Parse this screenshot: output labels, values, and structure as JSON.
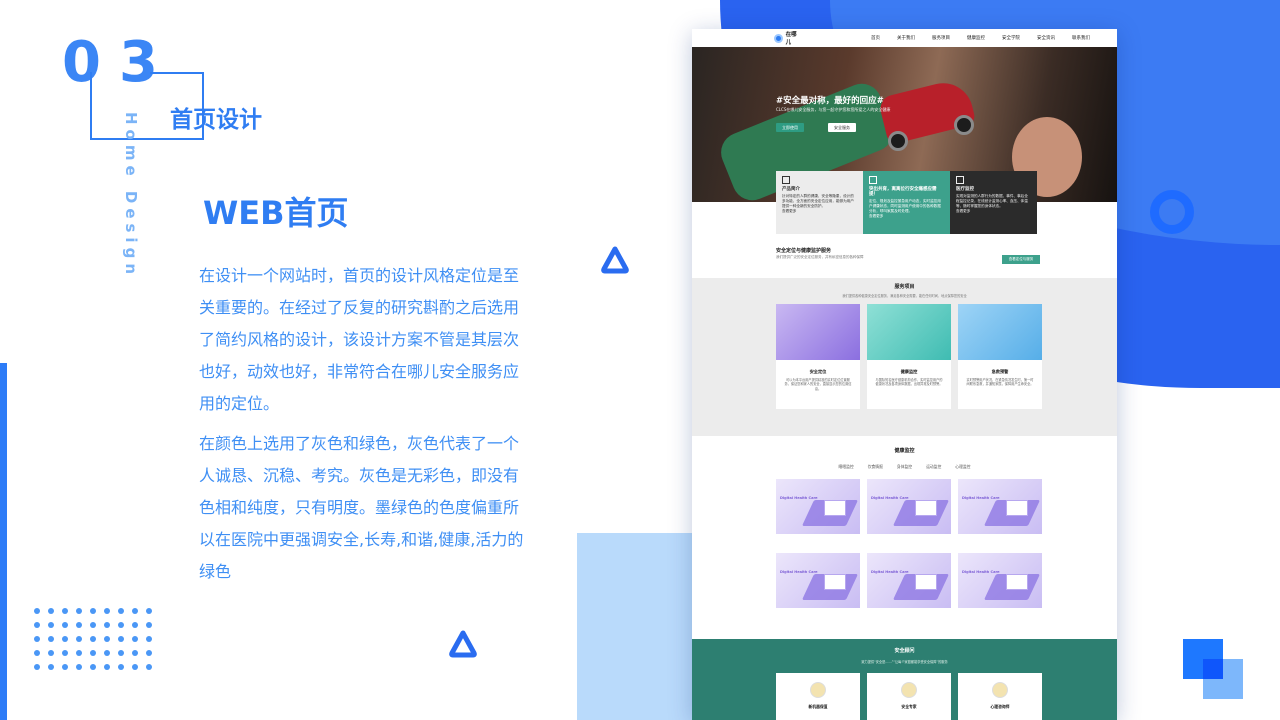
{
  "slide": {
    "number": "03",
    "section_title": "首页设计",
    "section_en": "Home Design",
    "heading": "WEB首页",
    "paragraph_1": "在设计一个网站时，首页的设计风格定位是至关重要的。在经过了反复的研究斟酌之后选用了简约风格的设计，该设计方案不管是其层次也好，动效也好，非常符合在哪儿安全服务应用的定位。",
    "paragraph_2": "在颜色上选用了灰色和绿色，灰色代表了一个人诚恳、沉稳、考究。灰色是无彩色，即没有色相和纯度，只有明度。墨绿色的色度偏重所以在医院中更强调安全,长寿,和谐,健康,活力的绿色"
  },
  "colors": {
    "accent": "#2f7df2",
    "mock_green": "#3da18c",
    "mock_dark_green": "#2d7f71",
    "mock_gray": "#ececec"
  },
  "mockup": {
    "logo_text": "在哪儿",
    "nav": [
      "首页",
      "关于我们",
      "服务项目",
      "健康监控",
      "安全学院",
      "安全资讯",
      "联系我们"
    ],
    "hero": {
      "title": "#安全最对称，最好的回应#",
      "subtitle": "CLCS在哪儿安全服务，与您一起守护您和您所爱之人的安全健康",
      "primary_button": "立即使用",
      "secondary_button": "安全服务"
    },
    "feature_cards": [
      {
        "title": "产品简介",
        "text": "针对特定的人群的健康、安全等隐患，设计的多功能、全方面的安全定位应用，能够为用户提供一种全新的安全防护。",
        "more": "查看更多"
      },
      {
        "title": "突出共育，离离位行安全痛感应需提！",
        "text": "定位、规划及监控紧急用户动态，实时监控用户健康状态，同时监测用户使用中的各种数据分析，呼叫家属及时处理。",
        "more": "查看更多"
      },
      {
        "title": "医疗监控",
        "text": "实现对监测的人群行为的数据、事件、事后全程监控记录，在线统计监测心率、血压、体温等，随时掌握您的身体状态。",
        "more": "查看更多"
      }
    ],
    "block2": {
      "title": "安全定位与健康监护服务",
      "subtitle": "我们提供广泛的安全定位服务，并有私密信息的各种保障",
      "button": "查看定位与服务"
    },
    "services": {
      "title": "服务项目",
      "subtitle": "我们提供各种健康安全定位服务，满足各种安全需要，能在任何时间、地点保障您的安全",
      "items": [
        {
          "name": "安全定位",
          "desc": "可以为本平台用户提供精准的实时定位位置服务，保证您和家人的安全，直接显示您的位置信息。"
        },
        {
          "name": "健康监控",
          "desc": "与国际知名医疗健康机构合作，实时监控用户的健康状况及各项身体数据，出现异常及时预警。"
        },
        {
          "name": "急救预警",
          "desc": "实时预警用户状况，在紧急情况发生时，第一时间联系急救，并通知家属，保障用户生命安全。"
        }
      ]
    },
    "health": {
      "title": "健康监控",
      "tabs": [
        "睡眠监控",
        "饮食情报",
        "身体监控",
        "运动监控",
        "心理监控"
      ],
      "card_label": "Digital Health Care"
    },
    "safety": {
      "title": "安全顾问",
      "subtitle": "致力提供“安全是……”“让每个家庭都能享受安全保障”的服务",
      "items": [
        "新机器保值",
        "安全专家",
        "心理咨询师"
      ]
    }
  }
}
